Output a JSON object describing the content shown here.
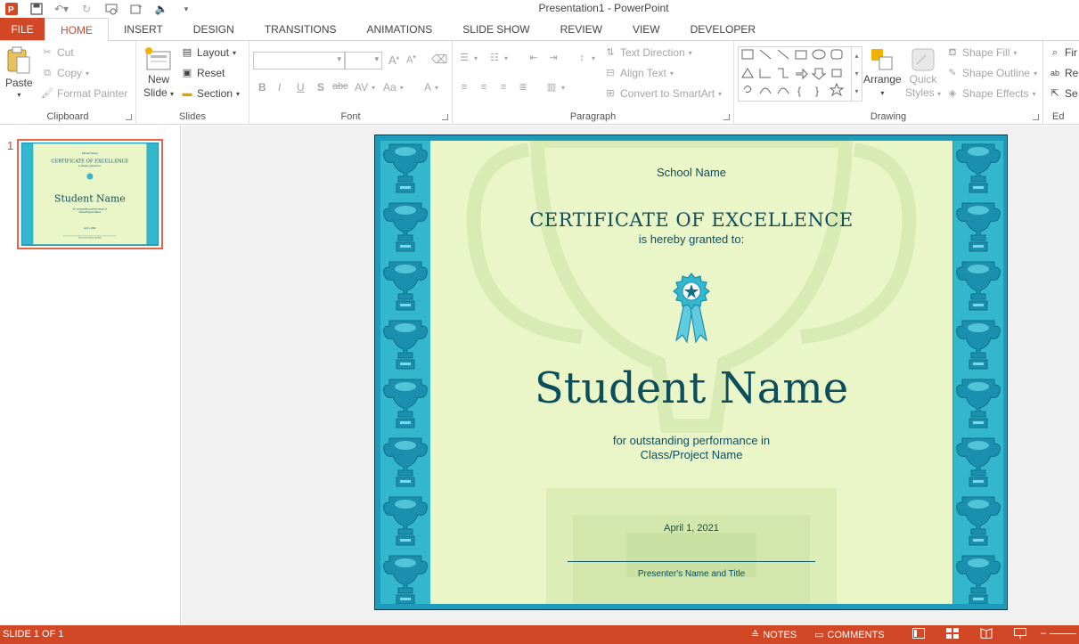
{
  "app": {
    "title": "Presentation1 - PowerPoint",
    "accent": "#d24726"
  },
  "quick_access": [
    {
      "icon": "powerpoint-logo-icon"
    },
    {
      "icon": "save-icon"
    },
    {
      "icon": "undo-icon"
    },
    {
      "icon": "redo-icon"
    },
    {
      "icon": "start-from-beginning-icon"
    },
    {
      "icon": "insert-picture-icon"
    },
    {
      "icon": "audio-icon"
    },
    {
      "icon": "customize-qat-icon"
    }
  ],
  "tabs": [
    "FILE",
    "HOME",
    "INSERT",
    "DESIGN",
    "TRANSITIONS",
    "ANIMATIONS",
    "SLIDE SHOW",
    "REVIEW",
    "VIEW",
    "DEVELOPER"
  ],
  "active_tab": "HOME",
  "ribbon": {
    "clipboard": {
      "label": "Clipboard",
      "paste": "Paste",
      "cut": "Cut",
      "copy": "Copy",
      "format_painter": "Format Painter"
    },
    "slides": {
      "label": "Slides",
      "new_slide_1": "New",
      "new_slide_2": "Slide",
      "layout": "Layout",
      "reset": "Reset",
      "section": "Section"
    },
    "font": {
      "label": "Font",
      "bold": "B",
      "italic": "I",
      "underline": "U",
      "shadow": "S",
      "strike": "abc",
      "spacing": "AV",
      "case": "Aa",
      "color": "A"
    },
    "paragraph": {
      "label": "Paragraph",
      "text_direction": "Text Direction",
      "align_text": "Align Text",
      "convert_smartart": "Convert to SmartArt"
    },
    "drawing": {
      "label": "Drawing",
      "arrange": "Arrange",
      "quick_styles_1": "Quick",
      "quick_styles_2": "Styles",
      "shape_fill": "Shape Fill",
      "shape_outline": "Shape Outline",
      "shape_effects": "Shape Effects"
    },
    "editing": {
      "label": "Ed",
      "find": "Fir",
      "replace": "Re",
      "select": "Se"
    }
  },
  "thumbnail": {
    "number": "1"
  },
  "slide": {
    "school_name": "School Name",
    "heading": "CERTIFICATE OF EXCELLENCE",
    "granted": "is hereby granted to:",
    "student_name": "Student Name",
    "performance": "for outstanding performance in",
    "class_name": "Class/Project Name",
    "date": "April 1, 2021",
    "presenter": "Presenter's Name and Title"
  },
  "status": {
    "slide_count": "SLIDE 1 OF 1",
    "notes": "NOTES",
    "comments": "COMMENTS"
  }
}
